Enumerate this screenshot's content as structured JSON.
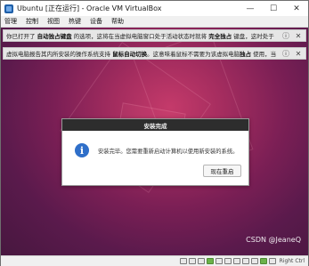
{
  "window": {
    "title": "Ubuntu [正在运行] - Oracle VM VirtualBox",
    "controls": {
      "minimize": "—",
      "maximize": "☐",
      "close": "✕"
    }
  },
  "menu": [
    "管理",
    "控制",
    "视图",
    "热键",
    "设备",
    "帮助"
  ],
  "notifications": [
    {
      "pre": "你已打开了 ",
      "bold1": "自动独占键盘",
      "mid": " 的选项，这将在当虚拟电脑窗口处于活动状态时就将 ",
      "bold2": "完全独占",
      "post": " 键盘，这时处于"
    },
    {
      "pre": "虚拟电脑报告其内所安装的操作系统支持 ",
      "bold1": "鼠标自动切换",
      "mid": "。这意味着鼠标不需要为该虚拟电脑",
      "bold2": "独占",
      "post": " 使用，当"
    }
  ],
  "dialog": {
    "title": "安装完成",
    "message": "安装完毕。您需要重新启动计算机以使用新安装的系统。",
    "button": "现在重启",
    "icon": "info-icon"
  },
  "watermark": "CSDN @JeaneQ",
  "statusbar": {
    "host_key": "Right Ctrl"
  },
  "colors": {
    "wallpaper_center": "#c43a6a",
    "wallpaper_edge": "#47173f",
    "dialog_titlebar": "#2d2d2d",
    "info_icon": "#2f6fc9"
  }
}
